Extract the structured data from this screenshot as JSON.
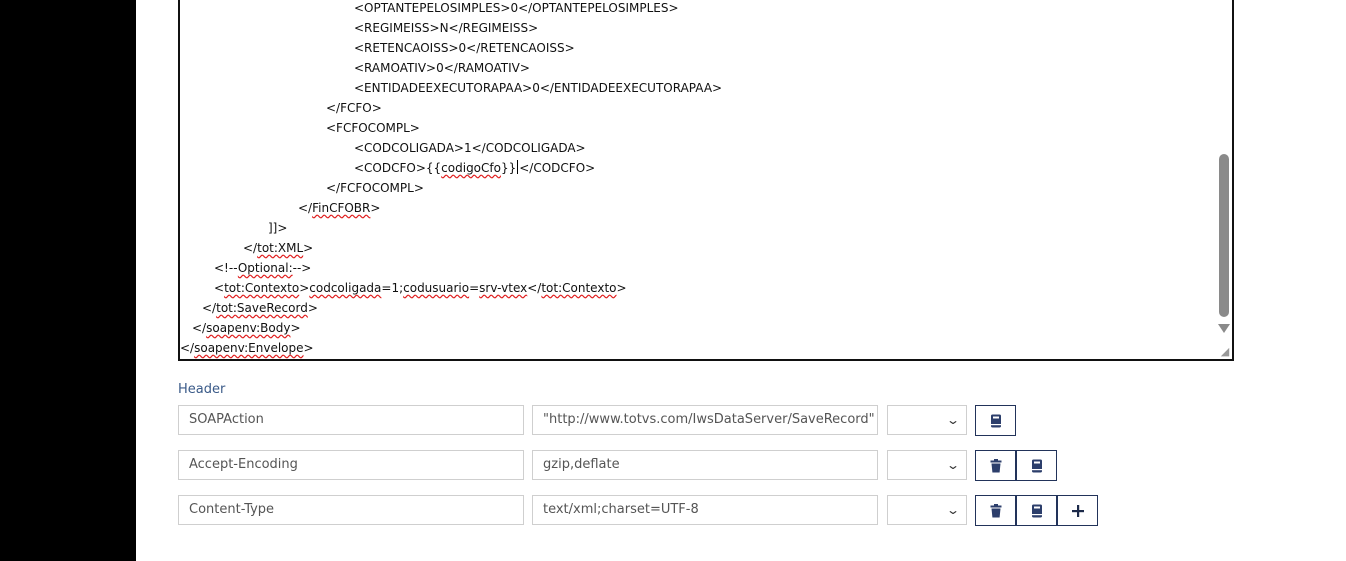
{
  "editor": {
    "lines": [
      {
        "indent": 174,
        "parts": [
          {
            "t": "<OPTANTEPELOSIMPLES>0</OPTANTEPELOSIMPLES>"
          }
        ]
      },
      {
        "indent": 174,
        "parts": [
          {
            "t": "<REGIMEISS>N</REGIMEISS>"
          }
        ]
      },
      {
        "indent": 174,
        "parts": [
          {
            "t": "<RETENCAOISS>0</RETENCAOISS>"
          }
        ]
      },
      {
        "indent": 174,
        "parts": [
          {
            "t": "<RAMOATIV>0</RAMOATIV>"
          }
        ]
      },
      {
        "indent": 174,
        "parts": [
          {
            "t": "<ENTIDADEEXECUTORAPAA>0</ENTIDADEEXECUTORAPAA>"
          }
        ]
      },
      {
        "indent": 146,
        "parts": [
          {
            "t": "</FCFO>"
          }
        ]
      },
      {
        "indent": 146,
        "parts": [
          {
            "t": "<FCFOCOMPL>"
          }
        ]
      },
      {
        "indent": 174,
        "parts": [
          {
            "t": "<CODCOLIGADA>1</CODCOLIGADA>"
          }
        ]
      },
      {
        "indent": 174,
        "parts": [
          {
            "t": "<CODCFO>{{"
          },
          {
            "t": "codigoCfo",
            "sq": true
          },
          {
            "t": "}}"
          },
          {
            "caret": true
          },
          {
            "t": "</CODCFO>"
          }
        ]
      },
      {
        "indent": 146,
        "parts": [
          {
            "t": "</FCFOCOMPL>"
          }
        ]
      },
      {
        "indent": 118,
        "parts": [
          {
            "t": "</"
          },
          {
            "t": "FinCFOBR",
            "sq": true
          },
          {
            "t": ">"
          }
        ]
      },
      {
        "indent": 88,
        "parts": [
          {
            "t": "]]>"
          }
        ]
      },
      {
        "indent": 63,
        "parts": [
          {
            "t": "</"
          },
          {
            "t": "tot:XML",
            "sq": true
          },
          {
            "t": ">"
          }
        ]
      },
      {
        "indent": 34,
        "parts": [
          {
            "t": "<!--"
          },
          {
            "t": "Optional:",
            "sq": true
          },
          {
            "t": "-->"
          }
        ]
      },
      {
        "indent": 34,
        "parts": [
          {
            "t": "<"
          },
          {
            "t": "tot:Contexto",
            "sq": true
          },
          {
            "t": ">"
          },
          {
            "t": "codcoligada",
            "sq": true
          },
          {
            "t": "=1;"
          },
          {
            "t": "codusuario",
            "sq": true
          },
          {
            "t": "="
          },
          {
            "t": "srv-vtex",
            "sq": true
          },
          {
            "t": "</"
          },
          {
            "t": "tot:Contexto",
            "sq": true
          },
          {
            "t": ">"
          }
        ]
      },
      {
        "indent": 22,
        "parts": [
          {
            "t": "</"
          },
          {
            "t": "tot:SaveRecord",
            "sq": true
          },
          {
            "t": ">"
          }
        ]
      },
      {
        "indent": 12,
        "parts": [
          {
            "t": "</"
          },
          {
            "t": "soapenv:Body",
            "sq": true
          },
          {
            "t": ">"
          }
        ]
      },
      {
        "indent": 0,
        "parts": [
          {
            "t": "</"
          },
          {
            "t": "soapenv:Envelope",
            "sq": true
          },
          {
            "t": ">"
          }
        ]
      }
    ]
  },
  "header": {
    "title": "Header",
    "rows": [
      {
        "name": "SOAPAction",
        "value": "\"http://www.totvs.com/IwsDataServer/SaveRecord\"",
        "buttons": [
          "book"
        ]
      },
      {
        "name": "Accept-Encoding",
        "value": "gzip,deflate",
        "buttons": [
          "trash",
          "book"
        ]
      },
      {
        "name": "Content-Type",
        "value": "text/xml;charset=UTF-8",
        "buttons": [
          "trash",
          "book",
          "plus"
        ]
      }
    ]
  },
  "icons": {
    "select_chevron": "chevron-down-icon",
    "resize": "resize-grip-icon"
  },
  "colors": {
    "button_border": "#22335a",
    "icon_fill": "#2c3e6b",
    "header_label": "#3a5a88",
    "squiggle": "#e02020"
  }
}
